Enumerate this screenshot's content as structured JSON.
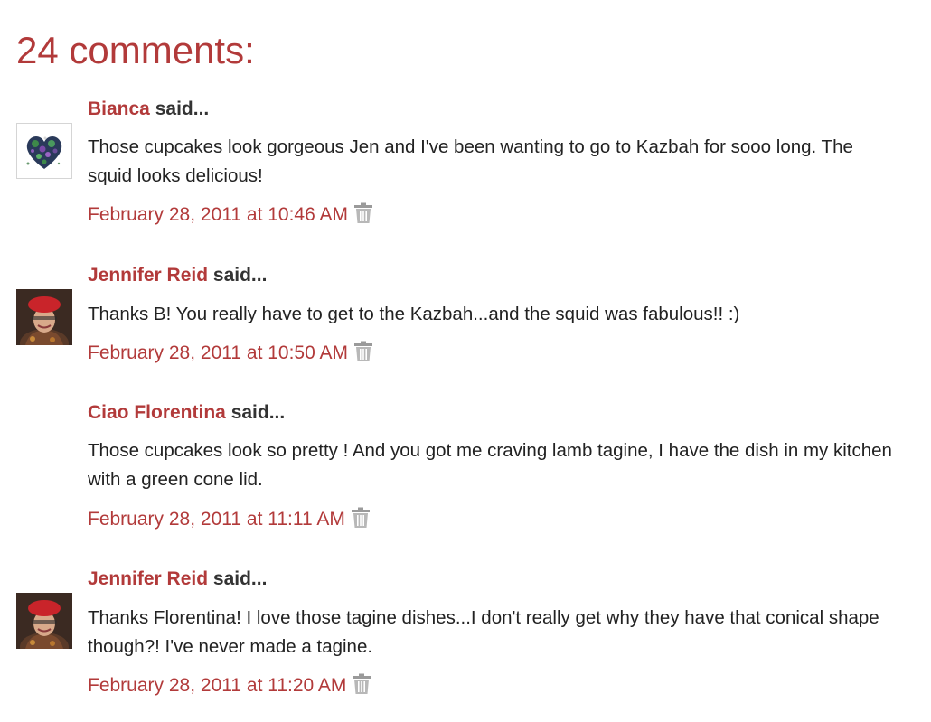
{
  "page": {
    "heading": "24 comments:"
  },
  "colors": {
    "accent": "#b23a3a",
    "text": "#222222",
    "icon_gray": "#999999"
  },
  "comments": [
    {
      "author": "Bianca",
      "said": "said...",
      "avatar": "heart-collage-avatar",
      "body": "Those cupcakes look gorgeous Jen and I've been wanting to go to Kazbah for sooo long. The squid looks delicious!",
      "timestamp": "February 28, 2011 at 10:46 AM",
      "delete_icon": "trash-icon"
    },
    {
      "author": "Jennifer Reid",
      "said": "said...",
      "avatar": "red-beret-portrait-avatar",
      "body": "Thanks B! You really have to get to the Kazbah...and the squid was fabulous!! :)",
      "timestamp": "February 28, 2011 at 10:50 AM",
      "delete_icon": "trash-icon"
    },
    {
      "author": "Ciao Florentina",
      "said": "said...",
      "avatar": "",
      "body": "Those cupcakes look so pretty ! And you got me craving lamb tagine, I have the dish in my kitchen with a green cone lid.",
      "timestamp": "February 28, 2011 at 11:11 AM",
      "delete_icon": "trash-icon"
    },
    {
      "author": "Jennifer Reid",
      "said": "said...",
      "avatar": "red-beret-portrait-avatar",
      "body": "Thanks Florentina! I love those tagine dishes...I don't really get why they have that conical shape though?! I've never made a tagine.",
      "timestamp": "February 28, 2011 at 11:20 AM",
      "delete_icon": "trash-icon"
    }
  ]
}
